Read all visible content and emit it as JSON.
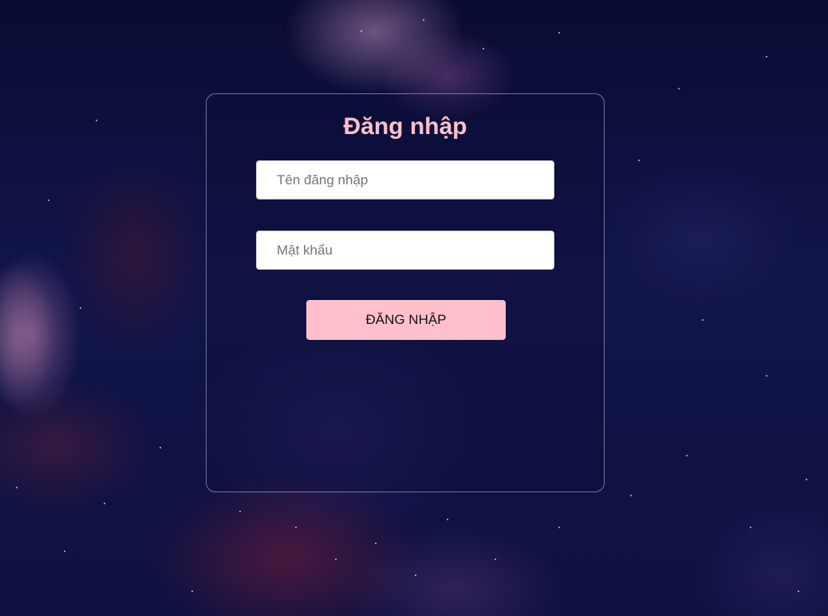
{
  "login": {
    "title": "Đăng nhập",
    "username_placeholder": "Tên đăng nhập",
    "username_value": "",
    "password_placeholder": "Mật khẩu",
    "password_value": "",
    "submit_label": "ĐĂNG NHẬP"
  },
  "theme": {
    "accent": "#ffc0cb",
    "background": "#0d0f3a"
  }
}
